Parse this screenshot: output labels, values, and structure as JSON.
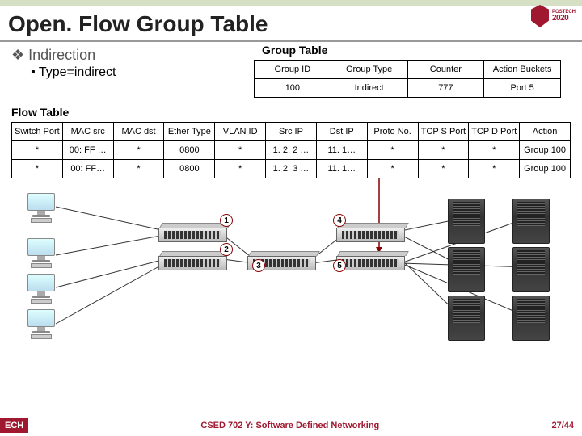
{
  "title": "Open. Flow Group Table",
  "logo": {
    "line1": "POSTECH",
    "line2": "2020"
  },
  "indirection": {
    "heading": "Indirection",
    "sub": "Type=indirect"
  },
  "group_table": {
    "label": "Group Table",
    "headers": [
      "Group ID",
      "Group Type",
      "Counter",
      "Action Buckets"
    ],
    "row": [
      "100",
      "Indirect",
      "777",
      "Port 5"
    ]
  },
  "flow_table": {
    "label": "Flow Table",
    "headers": [
      "Switch Port",
      "MAC src",
      "MAC dst",
      "Ether Type",
      "VLAN ID",
      "Src IP",
      "Dst IP",
      "Proto No.",
      "TCP S Port",
      "TCP D Port",
      "Action"
    ],
    "rows": [
      [
        "*",
        "00: FF …",
        "*",
        "0800",
        "*",
        "1. 2. 2 …",
        "11. 1…",
        "*",
        "*",
        "*",
        "Group 100"
      ],
      [
        "*",
        "00: FF…",
        "*",
        "0800",
        "*",
        "1. 2. 3 …",
        "11. 1…",
        "*",
        "*",
        "*",
        "Group 100"
      ]
    ]
  },
  "diagram_labels": [
    "1",
    "2",
    "3",
    "4",
    "5"
  ],
  "footer": {
    "left": "ECH",
    "center": "CSED 702 Y: Software Defined Networking",
    "page": "27/44"
  }
}
